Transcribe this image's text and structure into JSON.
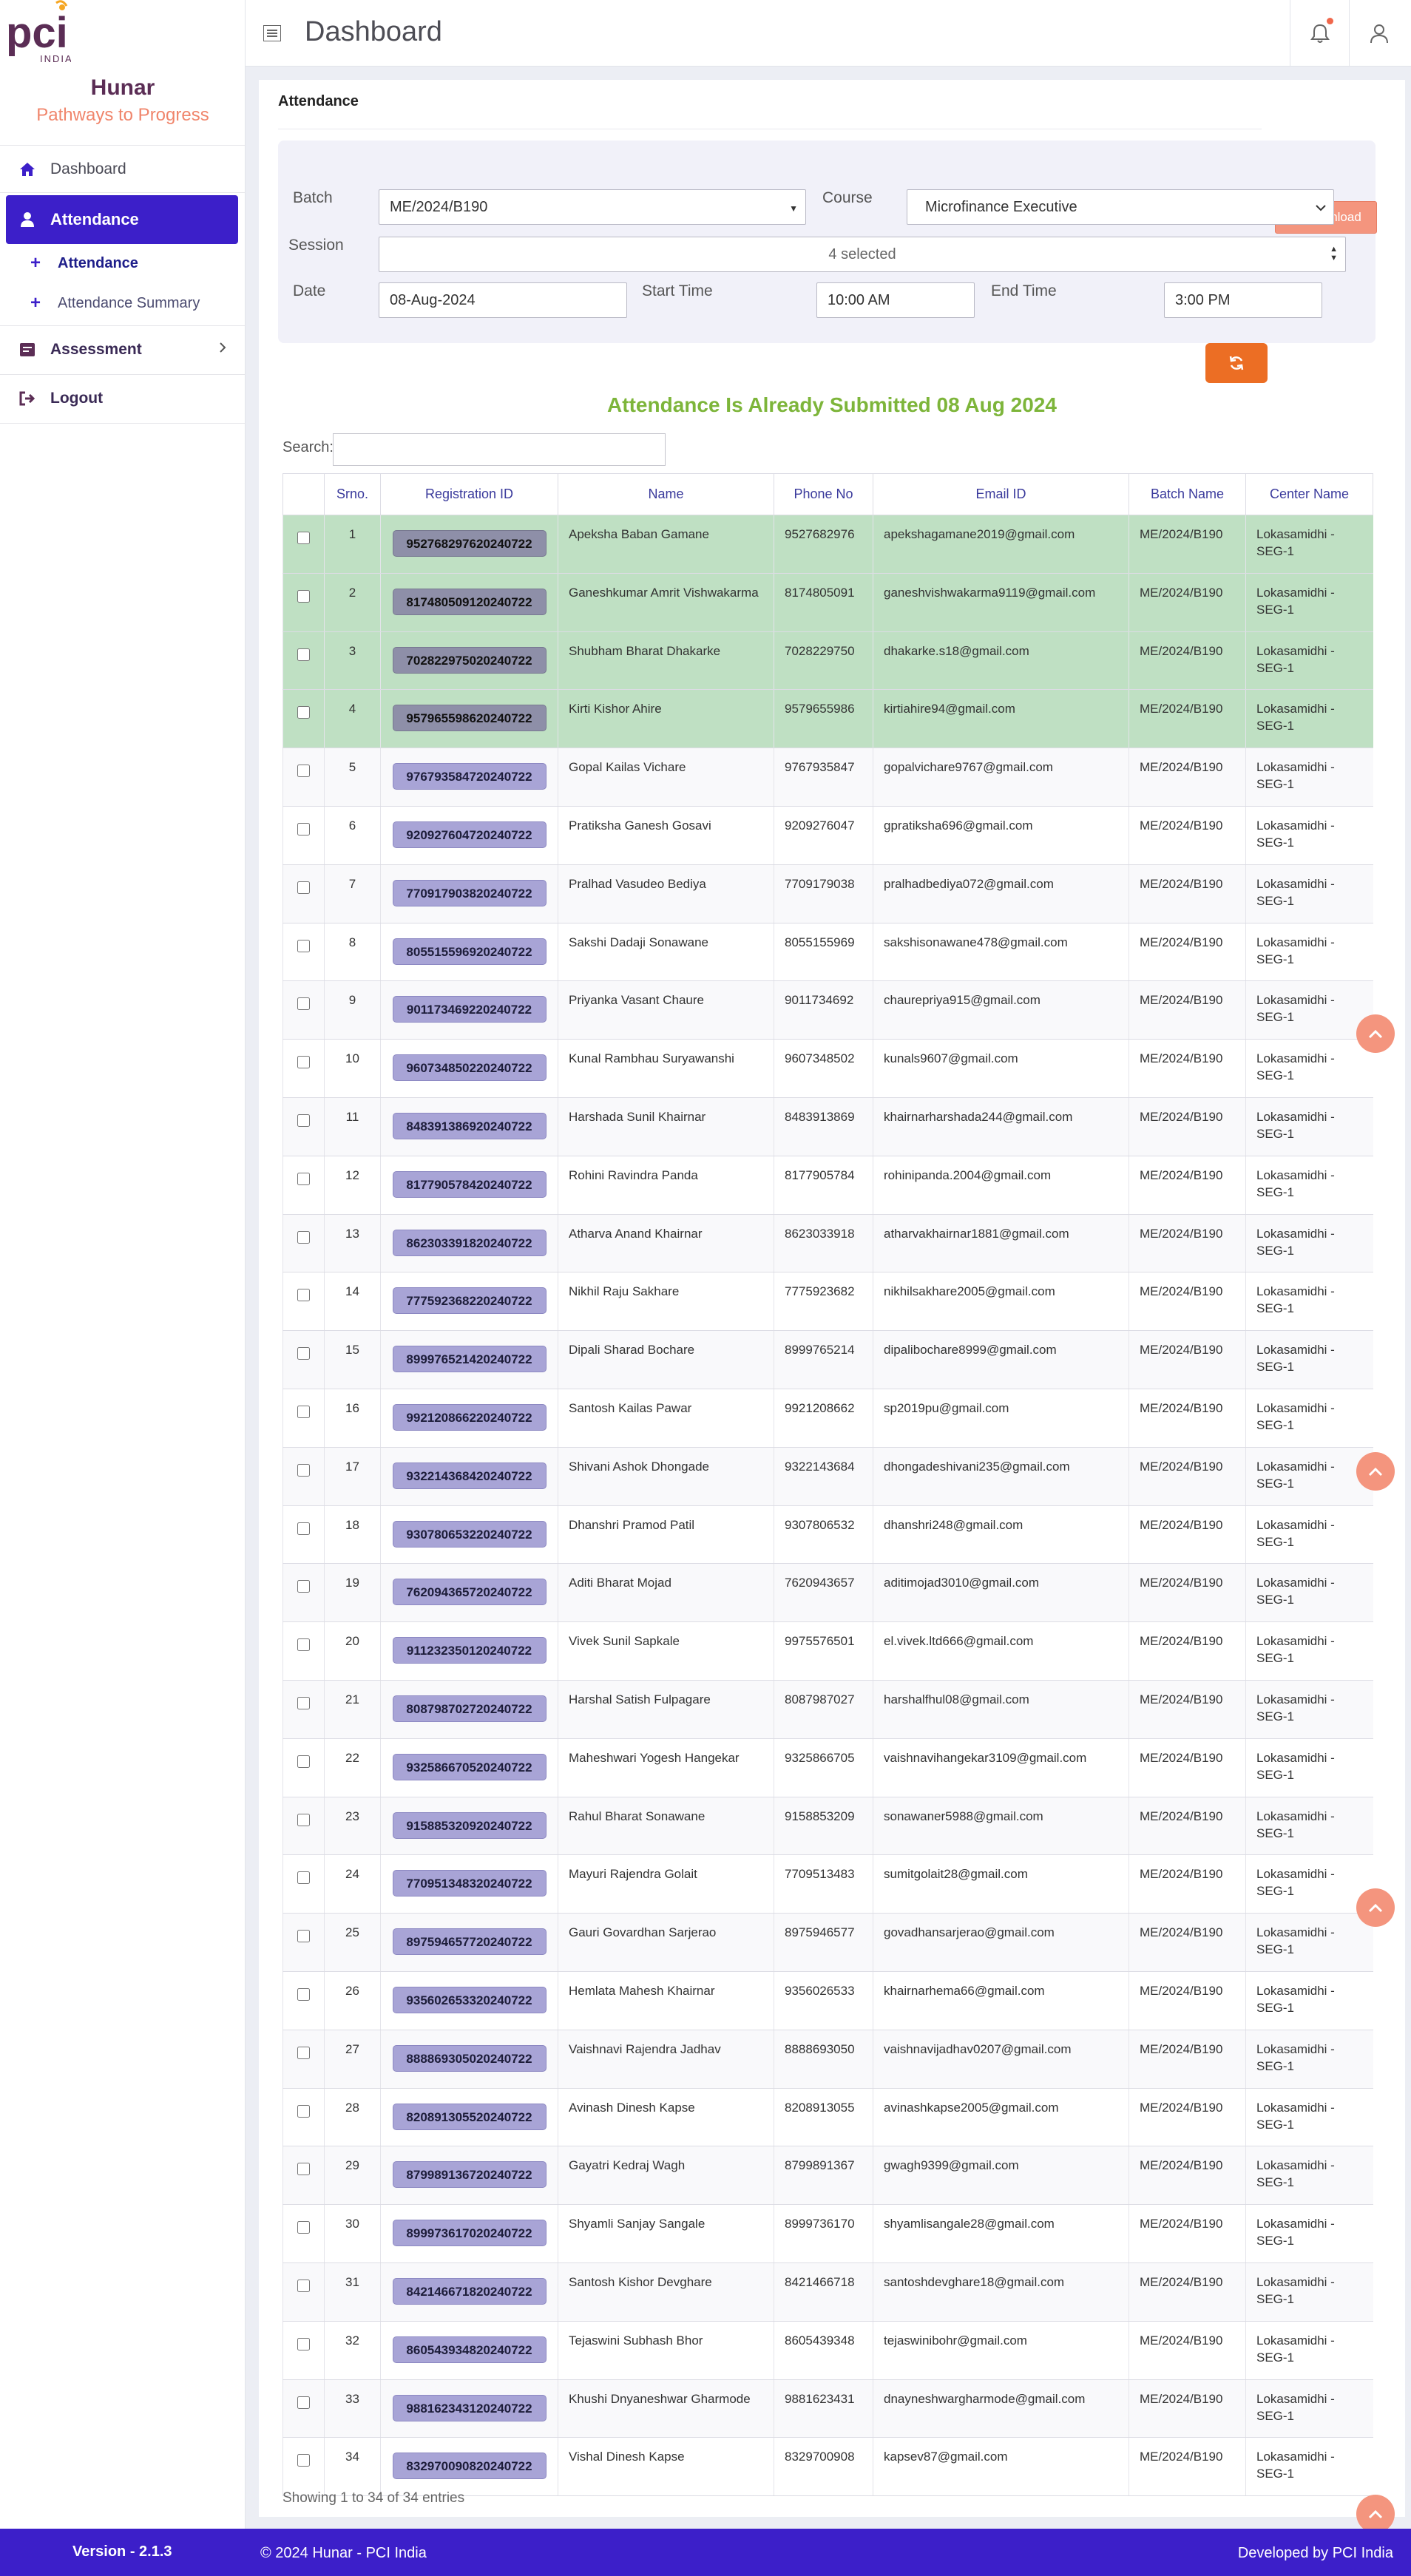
{
  "brand": {
    "logo_text": "pci",
    "logo_sub": "INDIA",
    "title": "Hunar",
    "subtitle": "Pathways to Progress"
  },
  "sidebar": {
    "items": [
      {
        "label": "Dashboard",
        "icon": "home-icon"
      },
      {
        "label": "Attendance",
        "icon": "user-icon"
      },
      {
        "label": "Assessment",
        "icon": "assessment-icon"
      },
      {
        "label": "Logout",
        "icon": "logout-icon"
      }
    ],
    "subitems": [
      {
        "label": "Attendance"
      },
      {
        "label": "Attendance Summary"
      }
    ]
  },
  "header": {
    "title": "Dashboard"
  },
  "page": {
    "card_title": "Attendance",
    "download_label": "Download"
  },
  "filters": {
    "batch_label": "Batch",
    "batch_value": "ME/2024/B190",
    "course_label": "Course",
    "course_value": "Microfinance Executive",
    "session_label": "Session",
    "session_value": "4 selected",
    "date_label": "Date",
    "date_value": "08-Aug-2024",
    "start_label": "Start Time",
    "start_value": "10:00 AM",
    "end_label": "End Time",
    "end_value": "3:00 PM"
  },
  "banner": "Attendance Is Already Submitted 08 Aug 2024",
  "search": {
    "label": "Search:",
    "value": ""
  },
  "table": {
    "headers": [
      "",
      "Srno.",
      "Registration ID",
      "Name",
      "Phone No",
      "Email ID",
      "Batch Name",
      "Center Name"
    ],
    "rows": [
      {
        "sr": "1",
        "rid": "952768297620240722",
        "name": "Apeksha Baban Gamane",
        "phone": "9527682976",
        "email": "apekshagamane2019@gmail.com",
        "batch": "ME/2024/B190",
        "center": "Lokasamidhi - SEG-1",
        "submitted": true
      },
      {
        "sr": "2",
        "rid": "817480509120240722",
        "name": "Ganeshkumar Amrit Vishwakarma",
        "phone": "8174805091",
        "email": "ganeshvishwakarma9119@gmail.com",
        "batch": "ME/2024/B190",
        "center": "Lokasamidhi - SEG-1",
        "submitted": true
      },
      {
        "sr": "3",
        "rid": "702822975020240722",
        "name": "Shubham Bharat Dhakarke",
        "phone": "7028229750",
        "email": "dhakarke.s18@gmail.com",
        "batch": "ME/2024/B190",
        "center": "Lokasamidhi - SEG-1",
        "submitted": true
      },
      {
        "sr": "4",
        "rid": "957965598620240722",
        "name": "Kirti Kishor Ahire",
        "phone": "9579655986",
        "email": "kirtiahire94@gmail.com",
        "batch": "ME/2024/B190",
        "center": "Lokasamidhi - SEG-1",
        "submitted": true
      },
      {
        "sr": "5",
        "rid": "976793584720240722",
        "name": "Gopal Kailas Vichare",
        "phone": "9767935847",
        "email": "gopalvichare9767@gmail.com",
        "batch": "ME/2024/B190",
        "center": "Lokasamidhi - SEG-1",
        "submitted": false
      },
      {
        "sr": "6",
        "rid": "920927604720240722",
        "name": "Pratiksha Ganesh Gosavi",
        "phone": "9209276047",
        "email": "gpratiksha696@gmail.com",
        "batch": "ME/2024/B190",
        "center": "Lokasamidhi - SEG-1",
        "submitted": false
      },
      {
        "sr": "7",
        "rid": "770917903820240722",
        "name": "Pralhad Vasudeo Bediya",
        "phone": "7709179038",
        "email": "pralhadbediya072@gmail.com",
        "batch": "ME/2024/B190",
        "center": "Lokasamidhi - SEG-1",
        "submitted": false
      },
      {
        "sr": "8",
        "rid": "805515596920240722",
        "name": "Sakshi Dadaji Sonawane",
        "phone": "8055155969",
        "email": "sakshisonawane478@gmail.com",
        "batch": "ME/2024/B190",
        "center": "Lokasamidhi - SEG-1",
        "submitted": false
      },
      {
        "sr": "9",
        "rid": "901173469220240722",
        "name": "Priyanka Vasant Chaure",
        "phone": "9011734692",
        "email": "chaurepriya915@gmail.com",
        "batch": "ME/2024/B190",
        "center": "Lokasamidhi - SEG-1",
        "submitted": false
      },
      {
        "sr": "10",
        "rid": "960734850220240722",
        "name": "Kunal Rambhau Suryawanshi",
        "phone": "9607348502",
        "email": "kunals9607@gmail.com",
        "batch": "ME/2024/B190",
        "center": "Lokasamidhi - SEG-1",
        "submitted": false
      },
      {
        "sr": "11",
        "rid": "848391386920240722",
        "name": "Harshada Sunil Khairnar",
        "phone": "8483913869",
        "email": "khairnarharshada244@gmail.com",
        "batch": "ME/2024/B190",
        "center": "Lokasamidhi - SEG-1",
        "submitted": false
      },
      {
        "sr": "12",
        "rid": "817790578420240722",
        "name": "Rohini Ravindra Panda",
        "phone": "8177905784",
        "email": "rohinipanda.2004@gmail.com",
        "batch": "ME/2024/B190",
        "center": "Lokasamidhi - SEG-1",
        "submitted": false
      },
      {
        "sr": "13",
        "rid": "862303391820240722",
        "name": "Atharva Anand Khairnar",
        "phone": "8623033918",
        "email": "atharvakhairnar1881@gmail.com",
        "batch": "ME/2024/B190",
        "center": "Lokasamidhi - SEG-1",
        "submitted": false
      },
      {
        "sr": "14",
        "rid": "777592368220240722",
        "name": "Nikhil Raju Sakhare",
        "phone": "7775923682",
        "email": "nikhilsakhare2005@gmail.com",
        "batch": "ME/2024/B190",
        "center": "Lokasamidhi - SEG-1",
        "submitted": false
      },
      {
        "sr": "15",
        "rid": "899976521420240722",
        "name": "Dipali Sharad Bochare",
        "phone": "8999765214",
        "email": "dipalibochare8999@gmail.com",
        "batch": "ME/2024/B190",
        "center": "Lokasamidhi - SEG-1",
        "submitted": false
      },
      {
        "sr": "16",
        "rid": "992120866220240722",
        "name": "Santosh Kailas Pawar",
        "phone": "9921208662",
        "email": "sp2019pu@gmail.com",
        "batch": "ME/2024/B190",
        "center": "Lokasamidhi - SEG-1",
        "submitted": false
      },
      {
        "sr": "17",
        "rid": "932214368420240722",
        "name": "Shivani Ashok Dhongade",
        "phone": "9322143684",
        "email": "dhongadeshivani235@gmail.com",
        "batch": "ME/2024/B190",
        "center": "Lokasamidhi - SEG-1",
        "submitted": false
      },
      {
        "sr": "18",
        "rid": "930780653220240722",
        "name": "Dhanshri Pramod Patil",
        "phone": "9307806532",
        "email": "dhanshri248@gmail.com",
        "batch": "ME/2024/B190",
        "center": "Lokasamidhi - SEG-1",
        "submitted": false
      },
      {
        "sr": "19",
        "rid": "762094365720240722",
        "name": "Aditi Bharat Mojad",
        "phone": "7620943657",
        "email": "aditimojad3010@gmail.com",
        "batch": "ME/2024/B190",
        "center": "Lokasamidhi - SEG-1",
        "submitted": false
      },
      {
        "sr": "20",
        "rid": "911232350120240722",
        "name": "Vivek Sunil Sapkale",
        "phone": "9975576501",
        "email": "el.vivek.ltd666@gmail.com",
        "batch": "ME/2024/B190",
        "center": "Lokasamidhi - SEG-1",
        "submitted": false
      },
      {
        "sr": "21",
        "rid": "808798702720240722",
        "name": "Harshal Satish Fulpagare",
        "phone": "8087987027",
        "email": "harshalfhul08@gmail.com",
        "batch": "ME/2024/B190",
        "center": "Lokasamidhi - SEG-1",
        "submitted": false
      },
      {
        "sr": "22",
        "rid": "932586670520240722",
        "name": "Maheshwari Yogesh Hangekar",
        "phone": "9325866705",
        "email": "vaishnavihangekar3109@gmail.com",
        "batch": "ME/2024/B190",
        "center": "Lokasamidhi - SEG-1",
        "submitted": false
      },
      {
        "sr": "23",
        "rid": "915885320920240722",
        "name": "Rahul Bharat Sonawane",
        "phone": "9158853209",
        "email": "sonawaner5988@gmail.com",
        "batch": "ME/2024/B190",
        "center": "Lokasamidhi - SEG-1",
        "submitted": false
      },
      {
        "sr": "24",
        "rid": "770951348320240722",
        "name": "Mayuri Rajendra Golait",
        "phone": "7709513483",
        "email": "sumitgolait28@gmail.com",
        "batch": "ME/2024/B190",
        "center": "Lokasamidhi - SEG-1",
        "submitted": false
      },
      {
        "sr": "25",
        "rid": "897594657720240722",
        "name": "Gauri Govardhan Sarjerao",
        "phone": "8975946577",
        "email": "govadhansarjerao@gmail.com",
        "batch": "ME/2024/B190",
        "center": "Lokasamidhi - SEG-1",
        "submitted": false
      },
      {
        "sr": "26",
        "rid": "935602653320240722",
        "name": "Hemlata Mahesh Khairnar",
        "phone": "9356026533",
        "email": "khairnarhema66@gmail.com",
        "batch": "ME/2024/B190",
        "center": "Lokasamidhi - SEG-1",
        "submitted": false
      },
      {
        "sr": "27",
        "rid": "888869305020240722",
        "name": "Vaishnavi Rajendra Jadhav",
        "phone": "8888693050",
        "email": "vaishnavijadhav0207@gmail.com",
        "batch": "ME/2024/B190",
        "center": "Lokasamidhi - SEG-1",
        "submitted": false
      },
      {
        "sr": "28",
        "rid": "820891305520240722",
        "name": "Avinash Dinesh Kapse",
        "phone": "8208913055",
        "email": "avinashkapse2005@gmail.com",
        "batch": "ME/2024/B190",
        "center": "Lokasamidhi - SEG-1",
        "submitted": false
      },
      {
        "sr": "29",
        "rid": "879989136720240722",
        "name": "Gayatri Kedraj Wagh",
        "phone": "8799891367",
        "email": "gwagh9399@gmail.com",
        "batch": "ME/2024/B190",
        "center": "Lokasamidhi - SEG-1",
        "submitted": false
      },
      {
        "sr": "30",
        "rid": "899973617020240722",
        "name": "Shyamli Sanjay Sangale",
        "phone": "8999736170",
        "email": "shyamlisangale28@gmail.com",
        "batch": "ME/2024/B190",
        "center": "Lokasamidhi - SEG-1",
        "submitted": false
      },
      {
        "sr": "31",
        "rid": "842146671820240722",
        "name": "Santosh Kishor Devghare",
        "phone": "8421466718",
        "email": "santoshdevghare18@gmail.com",
        "batch": "ME/2024/B190",
        "center": "Lokasamidhi - SEG-1",
        "submitted": false
      },
      {
        "sr": "32",
        "rid": "860543934820240722",
        "name": "Tejaswini Subhash Bhor",
        "phone": "8605439348",
        "email": "tejaswinibohr@gmail.com",
        "batch": "ME/2024/B190",
        "center": "Lokasamidhi - SEG-1",
        "submitted": false
      },
      {
        "sr": "33",
        "rid": "988162343120240722",
        "name": "Khushi Dnyaneshwar Gharmode",
        "phone": "9881623431",
        "email": "dnayneshwargharmode@gmail.com",
        "batch": "ME/2024/B190",
        "center": "Lokasamidhi - SEG-1",
        "submitted": false
      },
      {
        "sr": "34",
        "rid": "832970090820240722",
        "name": "Vishal Dinesh Kapse",
        "phone": "8329700908",
        "email": "kapsev87@gmail.com",
        "batch": "ME/2024/B190",
        "center": "Lokasamidhi - SEG-1",
        "submitted": false
      }
    ]
  },
  "table_info": "Showing 1 to 34 of 34 entries",
  "footer": {
    "version": "Version - 2.1.3",
    "copyright": "© 2024 Hunar - PCI India",
    "developer": "Developed by PCI India"
  },
  "colors": {
    "primary": "#3c1fc9",
    "submitted_row": "#bfe0c3",
    "banner": "#7db53a",
    "download": "#f4957e",
    "refresh": "#ec6e24",
    "brand_title": "#5b2d55",
    "brand_subtitle": "#f0856b"
  }
}
